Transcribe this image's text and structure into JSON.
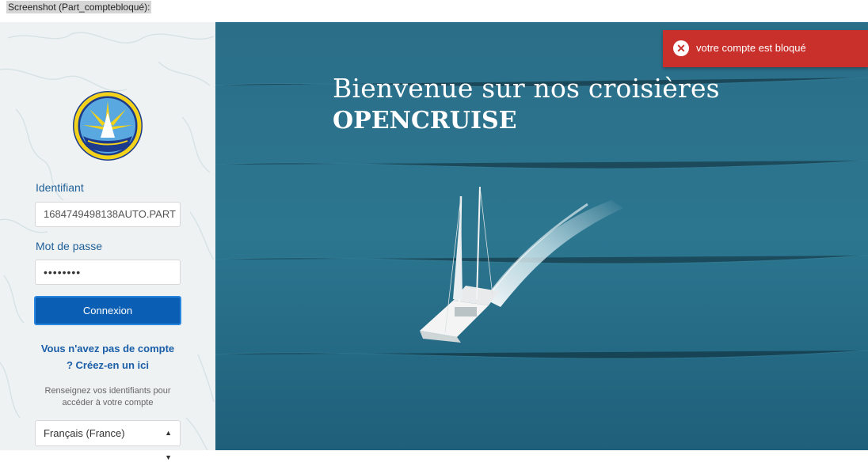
{
  "caption": "Screenshot (Part_comptebloqué):",
  "login": {
    "identifiant_label": "Identifiant",
    "identifiant_value": "1684749498138AUTO.PART",
    "password_label": "Mot de passe",
    "password_value": "••••••••",
    "submit_label": "Connexion",
    "signup_line1": "Vous n'avez pas de compte",
    "signup_line2": "? Créez-en un ici",
    "hint_line1": "Renseignez vos identifiants pour",
    "hint_line2": "accéder à votre compte",
    "language_selected": "Français (France)"
  },
  "hero": {
    "title_line1": "Bienvenue sur nos croisières",
    "title_line2": "OPENCRUISE"
  },
  "toast": {
    "message": "votre compte est bloqué"
  },
  "colors": {
    "toast": "#c9302c",
    "button": "#0a5fb4",
    "label": "#1f5f99",
    "sea": "#2c6f8a"
  }
}
